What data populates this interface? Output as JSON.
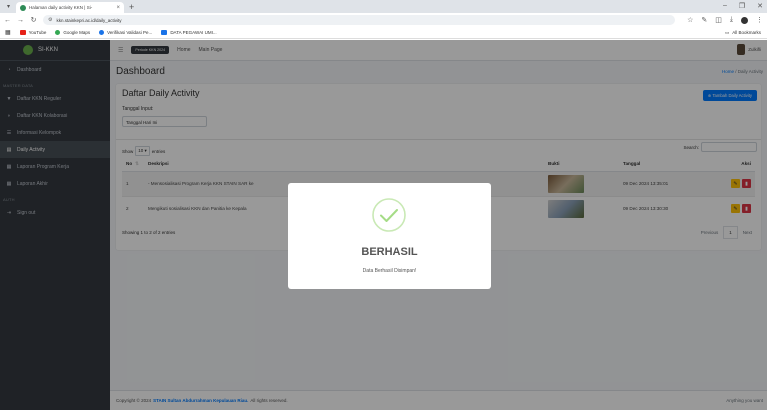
{
  "browser": {
    "tab_title": "Halaman daily activity KKN | Si-",
    "url": "kkn.stainkepri.ac.id/daily_activity",
    "bookmarks": [
      "YouTube",
      "Google Maps",
      "Verifikasi Validasi Pe...",
      "DATA PEGAWAI UMI..."
    ],
    "all_bookmarks": "All Bookmarks",
    "bookmark_colors": [
      "#e62117",
      "#34a853",
      "#1a73e8",
      "#1a73e8"
    ]
  },
  "app": {
    "brand": "SI-KKN",
    "sidebar": {
      "dashboard": "Dashboard",
      "section_master": "MASTER DATA",
      "items": [
        "Daftar KKN Reguler",
        "Daftar KKN Kolaborasi",
        "Informasi Kelompok",
        "Daily Activity",
        "Laporan Program Kerja",
        "Laporan Akhir"
      ],
      "section_auth": "AUTH",
      "sign_out": "Sign out"
    },
    "navbar": {
      "period": "Periode KKN 2024",
      "home": "Home",
      "main_page": "Main Page",
      "user": "Zulkifli"
    },
    "content": {
      "title": "Dashboard",
      "breadcrumb_home": "Home",
      "breadcrumb_sep": " / ",
      "breadcrumb_current": "Daily Activity"
    },
    "card": {
      "title": "Daftar Daily Activity",
      "date_label": "Tanggal Input:",
      "date_value": "Tanggal Hari Ini",
      "add_button": "Tambah Daily Activity",
      "show": "Show",
      "entries_value": "10",
      "entries": "entries",
      "search_label": "Search:",
      "columns": [
        "No",
        "Deskripsi",
        "Bukti",
        "Tanggal",
        "Aksi"
      ],
      "rows": [
        {
          "no": "1",
          "desc": "- Mensosialisasi Program Kerja KKN STAIN SAR ke",
          "date": "09 Dec 2024 13:35:01"
        },
        {
          "no": "2",
          "desc": "Mengikuti sosialisasi KKN dan Panitia ke Kepala",
          "date": "09 Dec 2024 13:30:30"
        }
      ],
      "info": "Showing 1 to 2 of 2 entries",
      "prev": "Previous",
      "page": "1",
      "next": "Next"
    },
    "footer": {
      "copyright_prefix": "Copyright © 2024",
      "institution": "STAIN Sultan Abdurrahman Kepulauan Riau.",
      "rights": "All rights reserved.",
      "right_text": "Anything you want"
    }
  },
  "modal": {
    "title": "BERHASIL",
    "text": "Data Berhasil Disimpan!"
  },
  "colors": {
    "sidebar_bg": "#343a40",
    "primary": "#007bff",
    "success_check": "#a5dc86",
    "warning": "#ffc107",
    "danger": "#dc3545"
  }
}
